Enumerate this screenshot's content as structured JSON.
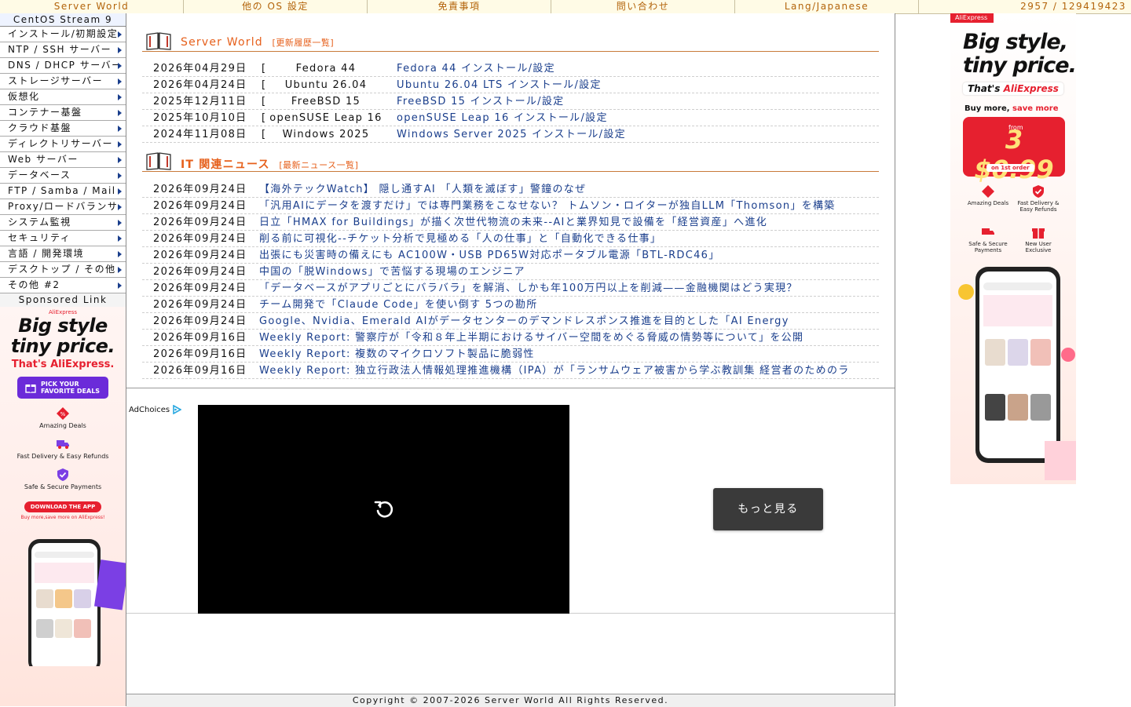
{
  "topbar": {
    "items": [
      "Server World",
      "他の OS 設定",
      "免責事項",
      "問い合わせ",
      "Lang/Japanese"
    ],
    "counter": "2957 / 129419423"
  },
  "sidebar": {
    "title": "CentOS Stream 9",
    "items": [
      "インストール/初期設定",
      "NTP / SSH サーバー",
      "DNS / DHCP サーバー",
      "ストレージサーバー",
      "仮想化",
      "コンテナー基盤",
      "クラウド基盤",
      "ディレクトリサーバー",
      "Web サーバー",
      "データベース",
      "FTP / Samba / Mail",
      "Proxy/ロードバランサ",
      "システム監視",
      "セキュリティ",
      "言語 / 開発環境",
      "デスクトップ / その他",
      "その他 #2"
    ],
    "sponsored_label": "Sponsored Link"
  },
  "left_ad": {
    "brand_small": "AliExpress",
    "headline_1": "Big style",
    "headline_2": "tiny price.",
    "subline": "That's AliExpress.",
    "button_line1": "PICK YOUR",
    "button_line2": "FAVORITE DEALS",
    "features": [
      "Amazing Deals",
      "Fast Delivery & Easy Refunds",
      "Safe & Secure Payments"
    ],
    "download_label": "DOWNLOAD THE APP",
    "download_sub": "Buy more,save more on AliExpress!"
  },
  "updates": {
    "title": "Server World",
    "link": "[更新履歴一覧]",
    "rows": [
      {
        "date": "2026年04月29日",
        "os": "Fedora 44",
        "link": "Fedora 44 インストール/設定"
      },
      {
        "date": "2026年04月24日",
        "os": "Ubuntu 26.04",
        "link": "Ubuntu 26.04 LTS インストール/設定"
      },
      {
        "date": "2025年12月11日",
        "os": "FreeBSD 15",
        "link": "FreeBSD 15 インストール/設定"
      },
      {
        "date": "2025年10月10日",
        "os": "openSUSE Leap 16",
        "link": "openSUSE Leap 16 インストール/設定"
      },
      {
        "date": "2024年11月08日",
        "os": "Windows 2025",
        "link": "Windows Server 2025 インストール/設定"
      }
    ],
    "bracket_open": "[",
    "bracket_close": "]"
  },
  "news": {
    "title": "IT 関連ニュース",
    "link": "[最新ニュース一覧]",
    "rows": [
      {
        "date": "2026年09月24日",
        "title": "【海外テックWatch】 隠し通すAI 「人類を滅ぼす」警鐘のなぜ"
      },
      {
        "date": "2026年09月24日",
        "title": "「汎用AIにデータを渡すだけ」では専門業務をこなせない？ トムソン・ロイターが独自LLM「Thomson」を構築"
      },
      {
        "date": "2026年09月24日",
        "title": "日立「HMAX for Buildings」が描く次世代物流の未来--AIと業界知見で設備を「経営資産」へ進化"
      },
      {
        "date": "2026年09月24日",
        "title": "削る前に可視化--チケット分析で見極める「人の仕事」と「自動化できる仕事」"
      },
      {
        "date": "2026年09月24日",
        "title": "出張にも災害時の備えにも AC100W・USB PD65W対応ポータブル電源「BTL-RDC46」"
      },
      {
        "date": "2026年09月24日",
        "title": "中国の「脱Windows」で苦悩する現場のエンジニア"
      },
      {
        "date": "2026年09月24日",
        "title": "「データベースがアプリごとにバラバラ」を解消、しかも年100万円以上を削減——金融機関はどう実現？"
      },
      {
        "date": "2026年09月24日",
        "title": "チーム開発で「Claude Code」を使い倒す 5つの勘所"
      },
      {
        "date": "2026年09月24日",
        "title": "Google、Nvidia、Emerald AIがデータセンターのデマンドレスポンス推進を目的とした「AI Energy"
      },
      {
        "date": "2026年09月16日",
        "title": "Weekly Report: 警察庁が「令和８年上半期におけるサイバー空間をめぐる脅威の情勢等について」を公開"
      },
      {
        "date": "2026年09月16日",
        "title": "Weekly Report: 複数のマイクロソフト製品に脆弱性"
      },
      {
        "date": "2026年09月16日",
        "title": "Weekly Report: 独立行政法人情報処理推進機構（IPA）が「ランサムウェア被害から学ぶ教訓集 経営者のためのラ"
      }
    ]
  },
  "video_ad": {
    "adchoices_label": "AdChoices",
    "more_button": "もっと見る"
  },
  "footer": {
    "copyright": "Copyright © 2007-2026 Server World All Rights Reserved."
  },
  "right_ad": {
    "tag": "AliExpress",
    "headline_1": "Big style,",
    "headline_2": "tiny price.",
    "thats": "That's ",
    "thats_brand": "AliExpress",
    "buy": "Buy more, ",
    "buy_accent": "save more",
    "from": "from",
    "price": "3 $0.99",
    "order": "on 1st order",
    "features": [
      "Amazing Deals",
      "Fast Delivery & Easy Refunds",
      "Safe & Secure Payments",
      "New User Exclusive"
    ]
  },
  "colors": {
    "link": "#1a3e8c",
    "accent_orange": "#e6601c",
    "topbar_text": "#b3640b",
    "ad_red": "#e6202f",
    "ad_purple": "#6b2bd9"
  }
}
